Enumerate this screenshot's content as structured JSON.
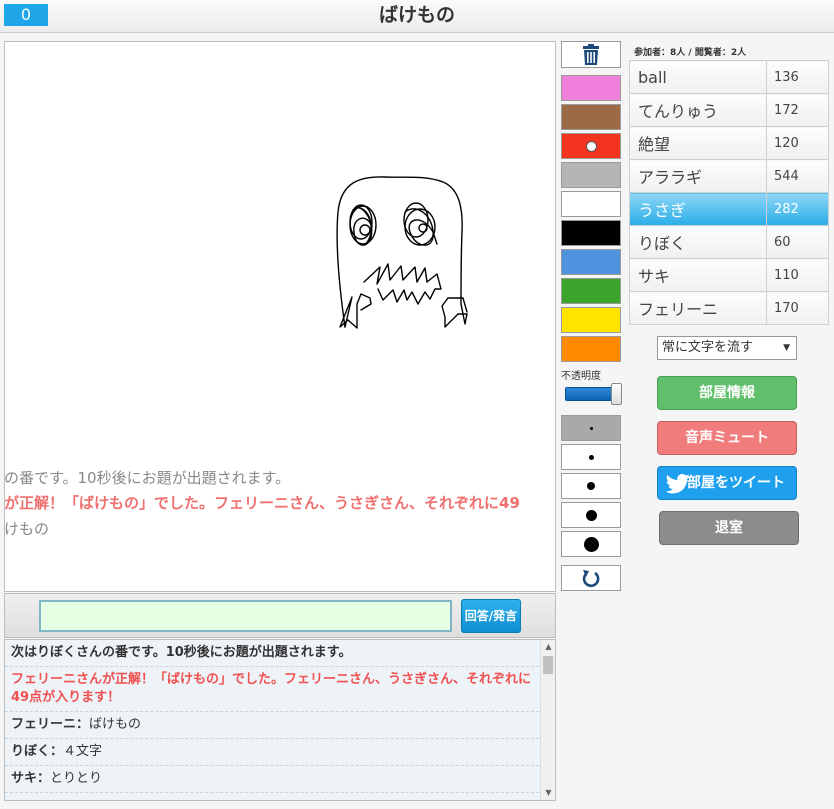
{
  "header": {
    "timer": "0",
    "title": "ばけもの"
  },
  "canvas_overlay": {
    "line1": "の番です。10秒後にお題が出題されます。",
    "line2": "が正解！「ばけもの」でした。フェリーニさん、うさぎさん、それぞれに49",
    "line3": "けもの"
  },
  "input": {
    "value": "",
    "button_label": "回答/発言"
  },
  "chat": {
    "items": [
      {
        "type": "system",
        "text": "次はりぼくさんの番です。10秒後にお題が出題されます。"
      },
      {
        "type": "correct",
        "text": "フェリーニさんが正解！「ばけもの」でした。フェリーニさん、うさぎさん、それぞれに49点が入ります！"
      },
      {
        "who": "フェリーニ：",
        "text": "ばけもの"
      },
      {
        "who": "りぼく：",
        "text": "４文字"
      },
      {
        "who": "サキ：",
        "text": "とりとり"
      }
    ]
  },
  "tools": {
    "colors": [
      "#f07fdc",
      "#9c6a44",
      "#f3341f",
      "#b5b5b5",
      "#ffffff",
      "#000000",
      "#4f92dd",
      "#3ba42a",
      "#ffe400",
      "#ff8a00"
    ],
    "selected_color": 2,
    "opacity_label": "不透明度",
    "opacity": 1.0,
    "pen_sizes": [
      1,
      3,
      6,
      9,
      13
    ]
  },
  "participants": {
    "label": "参加者：8人 / 閲覧者：2人",
    "players": [
      {
        "name": "ball",
        "score": "136"
      },
      {
        "name": "てんりゅう",
        "score": "172"
      },
      {
        "name": "絶望",
        "score": "120"
      },
      {
        "name": "アララギ",
        "score": "544"
      },
      {
        "name": "うさぎ",
        "score": "282",
        "active": true
      },
      {
        "name": "りぼく",
        "score": "60"
      },
      {
        "name": "サキ",
        "score": "110"
      },
      {
        "name": "フェリーニ",
        "score": "170"
      }
    ]
  },
  "controls": {
    "scroll_mode": "常に文字を流す",
    "room_info": "部屋情報",
    "mute": "音声ミュート",
    "tweet": "部屋をツイート",
    "leave": "退室"
  },
  "icons": {
    "trash": "trash-icon",
    "undo": "undo-icon",
    "tweet": "twitter-bird-icon"
  }
}
